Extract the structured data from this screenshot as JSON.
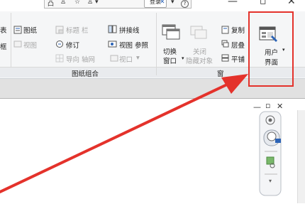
{
  "quick_access": {
    "login": "登录",
    "question": "?"
  },
  "ribbon": {
    "left_partial_1": "表",
    "left_partial_2": "框",
    "sheets": {
      "sheet": "图纸",
      "titleblock": "标题 栏",
      "view": "视图",
      "revision": "修订",
      "guide_grid": "导向 轴网",
      "viewport": "视口",
      "panel_label": "图纸组合"
    },
    "matchline": {
      "matchline": "拼接线",
      "view_ref": "视图 参照"
    },
    "windows": {
      "switch": "切换",
      "switch_line2": "窗口",
      "close_hidden": "关闭",
      "close_hidden_line2": "隐藏对象",
      "replicate": "复制",
      "cascade": "层叠",
      "tile": "平铺",
      "panel_label_partial": "窗"
    },
    "user_interface": {
      "line1": "用户",
      "line2": "界面"
    }
  },
  "colors": {
    "highlight": "#e4322b",
    "arrow": "#e4322b",
    "accent": "#2b63b6"
  }
}
